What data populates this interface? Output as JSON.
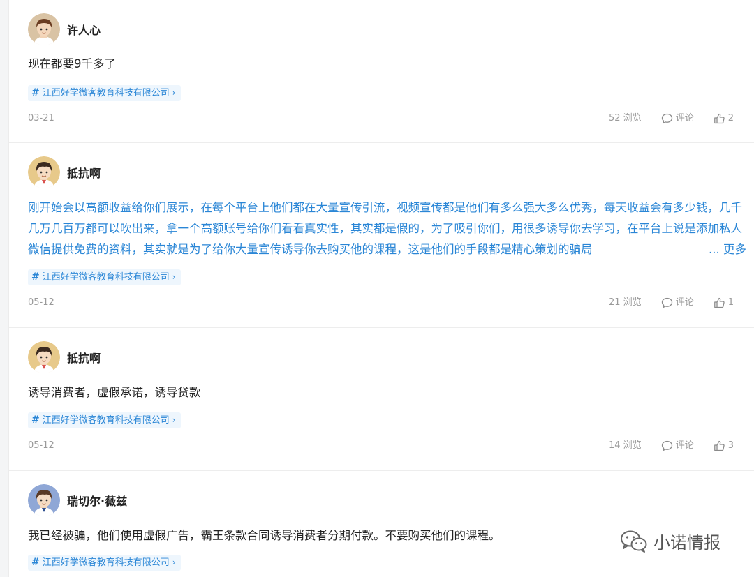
{
  "posts": [
    {
      "author": "许人心",
      "text": "现在都要9千多了",
      "tag": "江西好学微客教育科技有限公司",
      "date": "03-21",
      "views": "52 浏览",
      "comment_label": "评论",
      "likes": "2"
    },
    {
      "author": "抵抗啊",
      "text": "刚开始会以高额收益给你们展示，在每个平台上他们都在大量宣传引流，视频宣传都是他们有多么强大多么优秀，每天收益会有多少钱，几千几万几百万都可以吹出来，拿一个高额账号给你们看看真实性，其实都是假的，为了吸引你们，用很多诱导你去学习，在平台上说是添加私人微信提供免费的资料，其实就是为了给你大量宣传诱导你去购买他的课程，这是他们的手段都是精心策划的骗局",
      "more": "... 更多",
      "tag": "江西好学微客教育科技有限公司",
      "date": "05-12",
      "views": "21 浏览",
      "comment_label": "评论",
      "likes": "1"
    },
    {
      "author": "抵抗啊",
      "text": "诱导消费者，虚假承诺，诱导贷款",
      "tag": "江西好学微客教育科技有限公司",
      "date": "05-12",
      "views": "14 浏览",
      "comment_label": "评论",
      "likes": "3"
    },
    {
      "author": "瑞切尔·薇兹",
      "text": "我已经被骗，他们使用虚假广告，霸王条款合同诱导消费者分期付款。不要购买他们的课程。",
      "tag": "江西好学微客教育科技有限公司"
    }
  ],
  "watermark": "小诺情报",
  "icons": {
    "hash": "#",
    "chevron": "›",
    "comment": "speech-bubble-icon",
    "like": "thumbs-up-icon",
    "wechat": "wechat-logo-icon"
  },
  "colors": {
    "link": "#2a86d6",
    "tag_bg": "#eef6fd",
    "meta": "#9a9a9a",
    "avatar_bg_1": "#d9c3a4",
    "avatar_bg_2": "#e7c98a",
    "avatar_bg_3": "#8fa7d6"
  }
}
